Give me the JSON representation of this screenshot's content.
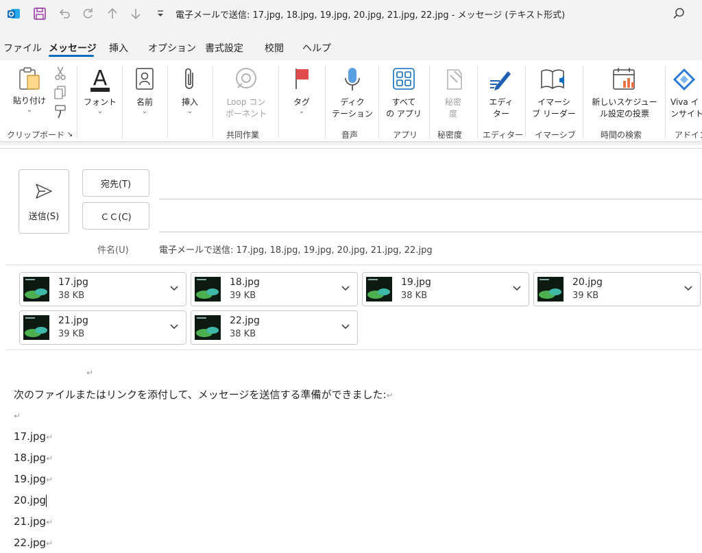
{
  "window": {
    "title": "電子メールで送信: 17.jpg, 18.jpg, 19.jpg, 20.jpg, 21.jpg, 22.jpg  -  メッセージ (テキスト形式)"
  },
  "menu": [
    "ファイル",
    "メッセージ",
    "挿入",
    "オプション",
    "書式設定",
    "校閲",
    "ヘルプ"
  ],
  "ribbon": {
    "paste": "貼り付け",
    "font": "フォント",
    "name": "名前",
    "insert": "挿入",
    "loop1": "Loop コン",
    "loop2": "ポーネント",
    "tag": "タグ",
    "dictate1": "ディク",
    "dictate2": "テーション",
    "apps1": "すべて",
    "apps2": "の アプリ",
    "sens1": "秘密",
    "sens2": "度",
    "editor1": "エディ",
    "editor2": "ター",
    "immersive1": "イマーシ",
    "immersive2": "ブ リーダー",
    "schedule1": "新しいスケジュー",
    "schedule2": "ル設定の投票",
    "viva1": "Viva イ",
    "viva2": "ンサイト",
    "groups": {
      "clipboard": "クリップボード",
      "collab": "共同作業",
      "voice": "音声",
      "apps": "アプリ",
      "sensitivity": "秘密度",
      "editor": "エディター",
      "immersive": "イマーシブ",
      "findtime": "時間の検索",
      "addins": "アドイン"
    }
  },
  "compose": {
    "send": "送信(S)",
    "to": "宛先(T)",
    "cc": "ＣＣ(C)",
    "subject_label": "件名(U)",
    "subject": "電子メールで送信: 17.jpg, 18.jpg, 19.jpg, 20.jpg, 21.jpg, 22.jpg"
  },
  "attachments": [
    {
      "name": "17.jpg",
      "size": "38 KB"
    },
    {
      "name": "18.jpg",
      "size": "39 KB"
    },
    {
      "name": "19.jpg",
      "size": "38 KB"
    },
    {
      "name": "20.jpg",
      "size": "39 KB"
    },
    {
      "name": "21.jpg",
      "size": "39 KB"
    },
    {
      "name": "22.jpg",
      "size": "38 KB"
    }
  ],
  "body": {
    "intro": "次のファイルまたはリンクを添付して、メッセージを送信する準備ができました:",
    "files": [
      "17.jpg",
      "18.jpg",
      "19.jpg",
      "20.jpg",
      "21.jpg",
      "22.jpg"
    ],
    "para_mark": "↵"
  },
  "colors": {
    "accent": "#0f6cbd",
    "save": "#9b3aa6",
    "tag": "#e04b4b",
    "outlook": "#0f6cbd"
  }
}
